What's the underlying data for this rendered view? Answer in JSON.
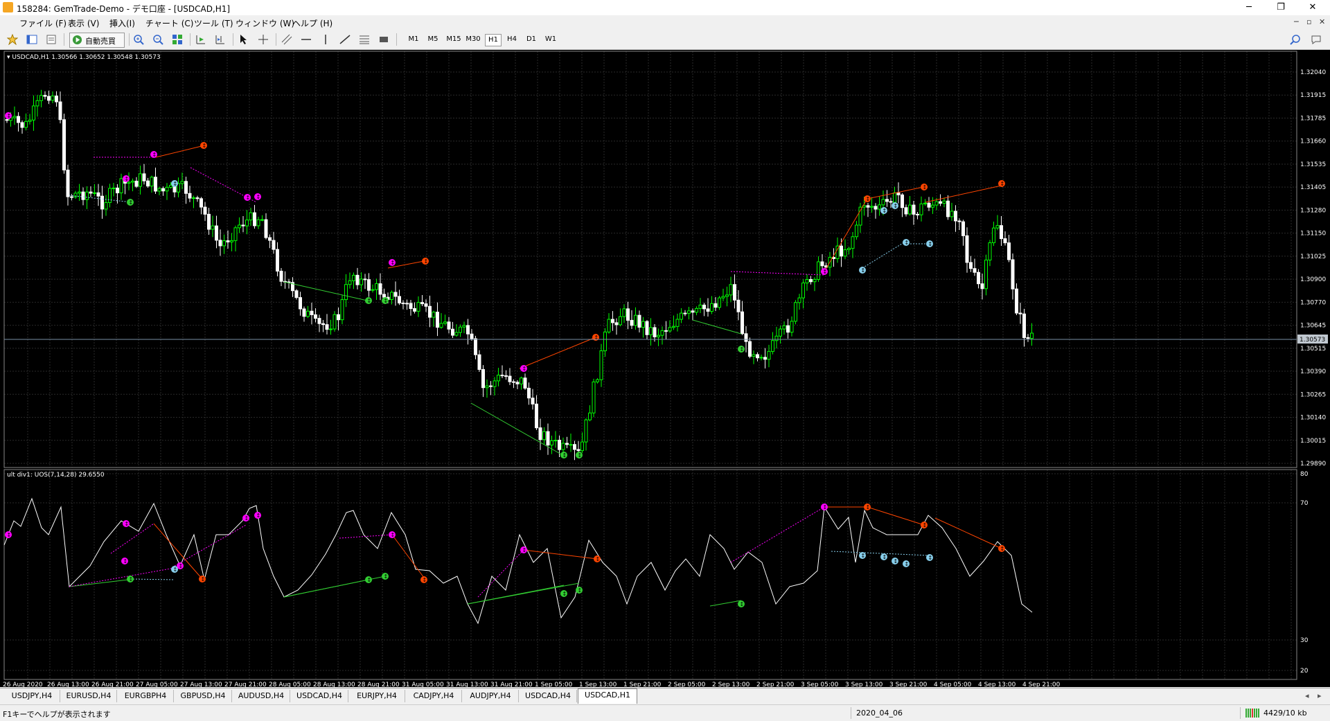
{
  "window": {
    "title": "158284: GemTrade-Demo - デモ口座 - [USDCAD,H1]",
    "btn_min": "─",
    "btn_max": "❐",
    "btn_close": "✕"
  },
  "menu": [
    "ファイル (F)",
    "表示 (V)",
    "挿入(I)",
    "チャート (C)",
    "ツール (T)",
    "ウィンドウ (W)",
    "ヘルプ (H)"
  ],
  "mdi": {
    "min": "─",
    "restore": "▫",
    "close": "✕"
  },
  "toolbar": {
    "auto_trade_label": "自動売買",
    "timeframes": [
      "M1",
      "M5",
      "M15",
      "M30",
      "H1",
      "H4",
      "D1",
      "W1"
    ],
    "active_timeframe": "H1"
  },
  "chart": {
    "header": "▾ USDCAD,H1  1.30566 1.30652 1.30548 1.30573",
    "current_price": "1.30573",
    "price_ticks": [
      "1.32040",
      "1.31915",
      "1.31785",
      "1.31660",
      "1.31535",
      "1.31405",
      "1.31280",
      "1.31150",
      "1.31025",
      "1.30900",
      "1.30770",
      "1.30645",
      "1.30515",
      "1.30390",
      "1.30265",
      "1.30140",
      "1.30015",
      "1.29890"
    ],
    "indicator_header": "ult div1: UOS(7,14,28) 29.6550",
    "indicator_ticks": [
      "80",
      "70",
      "30",
      "20"
    ],
    "time_labels": [
      "26 Aug 2020",
      "26 Aug 13:00",
      "26 Aug 21:00",
      "27 Aug 05:00",
      "27 Aug 13:00",
      "27 Aug 21:00",
      "28 Aug 05:00",
      "28 Aug 13:00",
      "28 Aug 21:00",
      "31 Aug 05:00",
      "31 Aug 13:00",
      "31 Aug 21:00",
      "1 Sep 05:00",
      "1 Sep 13:00",
      "1 Sep 21:00",
      "2 Sep 05:00",
      "2 Sep 13:00",
      "2 Sep 21:00",
      "3 Sep 05:00",
      "3 Sep 13:00",
      "3 Sep 21:00",
      "4 Sep 05:00",
      "4 Sep 13:00",
      "4 Sep 21:00"
    ],
    "colors": {
      "bull": "#00ff00",
      "bear": "#ffffff",
      "grid": "#2a2a2a",
      "bear_div": "#ff4500",
      "bull_div": "#32cd32",
      "hidden_bear": "#ff00ff",
      "hidden_bull": "#87ceeb"
    }
  },
  "tabs": [
    "USDJPY,H4",
    "EURUSD,H4",
    "EURGBPH4",
    "GBPUSD,H4",
    "AUDUSD,H4",
    "USDCAD,H4",
    "EURJPY,H4",
    "CADJPY,H4",
    "AUDJPY,H4",
    "USDCAD,H4",
    "USDCAD,H1"
  ],
  "active_tab": 10,
  "status": {
    "help": "F1キーでヘルプが表示されます",
    "date": "2020_04_06",
    "traffic": "4429/10 kb"
  }
}
